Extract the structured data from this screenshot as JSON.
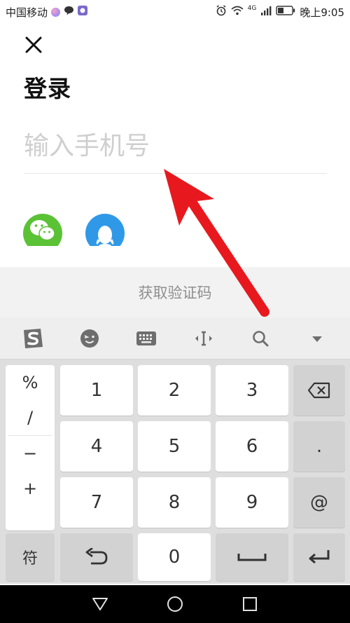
{
  "status_bar": {
    "carrier": "中国移动",
    "network": "4G",
    "time": "晚上9:05"
  },
  "page": {
    "title": "登录",
    "phone_placeholder": "输入手机号",
    "get_code_label": "获取验证码"
  },
  "social": [
    {
      "name": "wechat",
      "icon": "wechat-icon",
      "color": "#5bc236"
    },
    {
      "name": "qq",
      "icon": "qq-icon",
      "color": "#2f99e8"
    }
  ],
  "keyboard": {
    "toolbar": [
      "sogou-logo-icon",
      "emoji-icon",
      "keyboard-icon",
      "cursor-icon",
      "search-icon",
      "collapse-icon"
    ],
    "symbols": [
      "%",
      "/",
      "−",
      "+"
    ],
    "digits": [
      "1",
      "2",
      "3",
      "4",
      "5",
      "6",
      "7",
      "8",
      "9",
      "0"
    ],
    "right_keys": [
      ".",
      "@"
    ],
    "symbol_key": "符"
  },
  "colors": {
    "accent_red": "#e8191e",
    "keyboard_bg": "#dedede"
  }
}
